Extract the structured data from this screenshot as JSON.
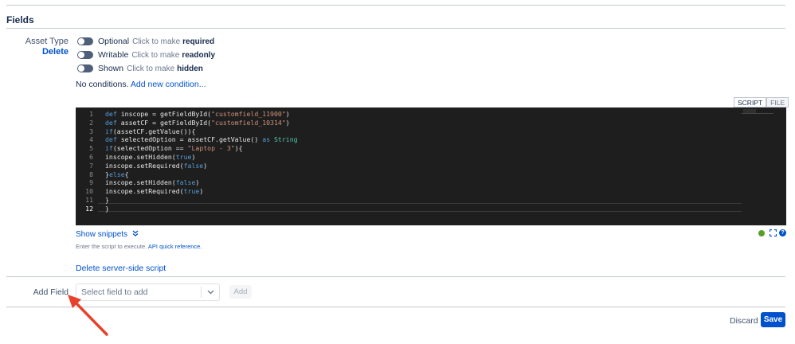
{
  "section": {
    "title": "Fields"
  },
  "field": {
    "label": "Asset Type",
    "delete_label": "Delete",
    "toggles": [
      {
        "name": "Optional",
        "hint": "Click to make",
        "hint_strong": "required"
      },
      {
        "name": "Writable",
        "hint": "Click to make",
        "hint_strong": "readonly"
      },
      {
        "name": "Shown",
        "hint": "Click to make",
        "hint_strong": "hidden"
      }
    ],
    "conditions_text": "No conditions.",
    "add_condition_label": "Add new condition..."
  },
  "editor": {
    "tabs": [
      "SCRIPT",
      "FILE"
    ],
    "active_tab": "SCRIPT",
    "current_line": 12,
    "lines": [
      "def inscope = getFieldById(\"customfield_11900\")",
      "def assetCF = getFieldById(\"customfield_10314\")",
      "if(assetCF.getValue()){",
      "def selectedOption = assetCF.getValue() as String",
      "if(selectedOption == \"Laptop - 3\"){",
      "inscope.setHidden(true)",
      "inscope.setRequired(false)",
      "}else{",
      "inscope.setHidden(false)",
      "inscope.setRequired(true)",
      "}",
      "}"
    ],
    "show_snippets_label": "Show snippets",
    "help_text": "Enter the script to execute.",
    "api_link_label": "API quick reference.",
    "delete_script_label": "Delete server-side script"
  },
  "add_field": {
    "label": "Add Field",
    "select_placeholder": "Select field to add",
    "add_button_label": "Add"
  },
  "footer": {
    "discard_label": "Discard",
    "save_label": "Save"
  },
  "colors": {
    "accent": "#0052cc",
    "editor_bg": "#1e1e1e",
    "annotation_arrow": "#e8402a"
  }
}
